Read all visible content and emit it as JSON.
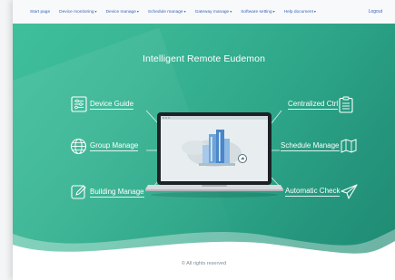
{
  "nav": {
    "items": [
      {
        "label": "Start page"
      },
      {
        "label": "Device monitoring"
      },
      {
        "label": "Device manage"
      },
      {
        "label": "Schedule manage"
      },
      {
        "label": "Gateway manage"
      },
      {
        "label": "Software setting"
      },
      {
        "label": "Help document"
      }
    ],
    "logout": "Logout"
  },
  "hero": {
    "title": "Intelligent Remote Eudemon",
    "features_left": [
      {
        "label": "Device Guide",
        "icon": "sliders-icon"
      },
      {
        "label": "Group Manage",
        "icon": "globe-icon"
      },
      {
        "label": "Building Manage",
        "icon": "edit-icon"
      }
    ],
    "features_right": [
      {
        "label": "Centralized Ctrl",
        "icon": "clipboard-icon"
      },
      {
        "label": "Schedule Manage",
        "icon": "map-icon"
      },
      {
        "label": "Automatic Check",
        "icon": "send-icon"
      }
    ]
  },
  "footer": {
    "copyright": "© All rights reserved"
  },
  "colors": {
    "hero_start": "#3fbf9c",
    "hero_end": "#1f8a73",
    "nav_link": "#3c64b4"
  }
}
